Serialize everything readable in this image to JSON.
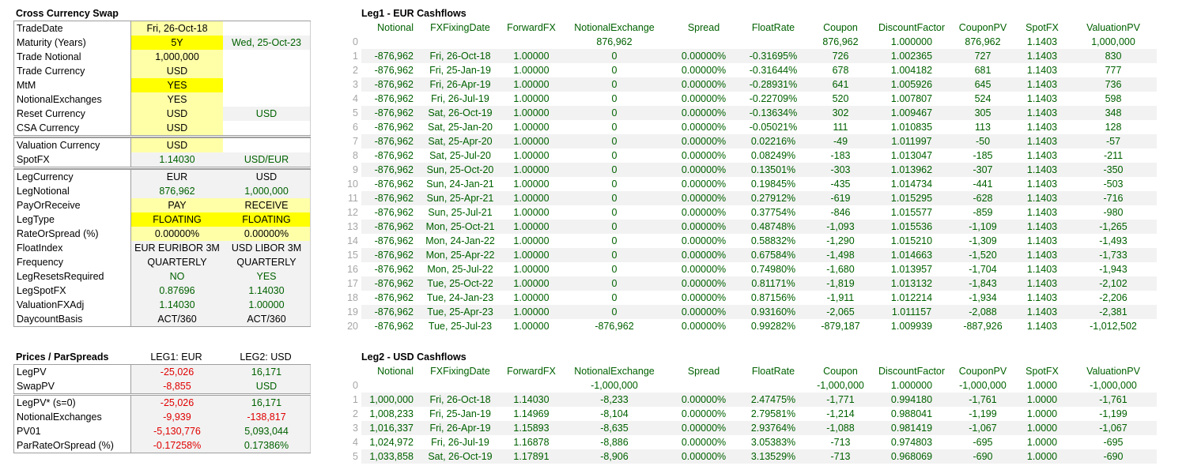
{
  "swap_panel": {
    "title": "Cross Currency Swap",
    "rows": [
      {
        "label": "TradeDate",
        "v1": "Fri, 26-Oct-18",
        "v2": ""
      },
      {
        "label": "Maturity (Years)",
        "v1": "5Y",
        "v2": "Wed, 25-Oct-23"
      },
      {
        "label": "Trade Notional",
        "v1": "1,000,000",
        "v2": ""
      },
      {
        "label": "Trade Currency",
        "v1": "USD",
        "v2": ""
      },
      {
        "label": "MtM",
        "v1": "YES",
        "v2": ""
      },
      {
        "label": "NotionalExchanges",
        "v1": "YES",
        "v2": ""
      },
      {
        "label": "Reset Currency",
        "v1": "USD",
        "v2": "USD"
      },
      {
        "label": "CSA Currency",
        "v1": "USD",
        "v2": ""
      },
      {
        "label": "Valuation Currency",
        "v1": "USD",
        "v2": ""
      },
      {
        "label": "SpotFX",
        "v1": "1.14030",
        "v2": "USD/EUR"
      },
      {
        "label": "LegCurrency",
        "v1": "EUR",
        "v2": "USD"
      },
      {
        "label": "LegNotional",
        "v1": "876,962",
        "v2": "1,000,000"
      },
      {
        "label": "PayOrReceive",
        "v1": "PAY",
        "v2": "RECEIVE"
      },
      {
        "label": "LegType",
        "v1": "FLOATING",
        "v2": "FLOATING"
      },
      {
        "label": "RateOrSpread (%)",
        "v1": "0.00000%",
        "v2": "0.00000%"
      },
      {
        "label": "FloatIndex",
        "v1": "EUR EURIBOR 3M",
        "v2": "USD LIBOR 3M"
      },
      {
        "label": "Frequency",
        "v1": "QUARTERLY",
        "v2": "QUARTERLY"
      },
      {
        "label": "LegResetsRequired",
        "v1": "NO",
        "v2": "YES"
      },
      {
        "label": "LegSpotFX",
        "v1": "0.87696",
        "v2": "1.14030"
      },
      {
        "label": "ValuationFXAdj",
        "v1": "1.14030",
        "v2": "1.00000"
      },
      {
        "label": "DaycountBasis",
        "v1": "ACT/360",
        "v2": "ACT/360"
      }
    ]
  },
  "prices_panel": {
    "title": "Prices / ParSpreads",
    "col1": "LEG1: EUR",
    "col2": "LEG2: USD",
    "rows": [
      {
        "label": "LegPV",
        "v1": "-25,026",
        "v2": "16,171"
      },
      {
        "label": "SwapPV",
        "v1": "-8,855",
        "v2": "USD"
      },
      {
        "label": "LegPV* (s=0)",
        "v1": "-25,026",
        "v2": "16,171"
      },
      {
        "label": "NotionalExchanges",
        "v1": "-9,939",
        "v2": "-138,817"
      },
      {
        "label": "PV01",
        "v1": "-5,130,776",
        "v2": "5,093,044"
      },
      {
        "label": "ParRateOrSpread (%)",
        "v1": "-0.17258%",
        "v2": "0.17386%"
      }
    ]
  },
  "leg1": {
    "title": "Leg1 - EUR Cashflows",
    "columns": [
      "Notional",
      "FXFixingDate",
      "ForwardFX",
      "NotionalExchange",
      "Spread",
      "FloatRate",
      "Coupon",
      "DiscountFactor",
      "CouponPV",
      "SpotFX",
      "ValuationPV"
    ],
    "rows": [
      [
        "0",
        "",
        "",
        "",
        "876,962",
        "",
        "",
        "876,962",
        "1.000000",
        "876,962",
        "1.1403",
        "1,000,000"
      ],
      [
        "1",
        "-876,962",
        "Fri, 26-Oct-18",
        "1.00000",
        "0",
        "0.00000%",
        "-0.31695%",
        "726",
        "1.002365",
        "727",
        "1.1403",
        "830"
      ],
      [
        "2",
        "-876,962",
        "Fri, 25-Jan-19",
        "1.00000",
        "0",
        "0.00000%",
        "-0.31644%",
        "678",
        "1.004182",
        "681",
        "1.1403",
        "777"
      ],
      [
        "3",
        "-876,962",
        "Fri, 26-Apr-19",
        "1.00000",
        "0",
        "0.00000%",
        "-0.28931%",
        "641",
        "1.005926",
        "645",
        "1.1403",
        "736"
      ],
      [
        "4",
        "-876,962",
        "Fri, 26-Jul-19",
        "1.00000",
        "0",
        "0.00000%",
        "-0.22709%",
        "520",
        "1.007807",
        "524",
        "1.1403",
        "598"
      ],
      [
        "5",
        "-876,962",
        "Sat, 26-Oct-19",
        "1.00000",
        "0",
        "0.00000%",
        "-0.13634%",
        "302",
        "1.009467",
        "305",
        "1.1403",
        "348"
      ],
      [
        "6",
        "-876,962",
        "Sat, 25-Jan-20",
        "1.00000",
        "0",
        "0.00000%",
        "-0.05021%",
        "111",
        "1.010835",
        "113",
        "1.1403",
        "128"
      ],
      [
        "7",
        "-876,962",
        "Sat, 25-Apr-20",
        "1.00000",
        "0",
        "0.00000%",
        "0.02216%",
        "-49",
        "1.011997",
        "-50",
        "1.1403",
        "-57"
      ],
      [
        "8",
        "-876,962",
        "Sat, 25-Jul-20",
        "1.00000",
        "0",
        "0.00000%",
        "0.08249%",
        "-183",
        "1.013047",
        "-185",
        "1.1403",
        "-211"
      ],
      [
        "9",
        "-876,962",
        "Sun, 25-Oct-20",
        "1.00000",
        "0",
        "0.00000%",
        "0.13501%",
        "-303",
        "1.013962",
        "-307",
        "1.1403",
        "-350"
      ],
      [
        "10",
        "-876,962",
        "Sun, 24-Jan-21",
        "1.00000",
        "0",
        "0.00000%",
        "0.19845%",
        "-435",
        "1.014734",
        "-441",
        "1.1403",
        "-503"
      ],
      [
        "11",
        "-876,962",
        "Sun, 25-Apr-21",
        "1.00000",
        "0",
        "0.00000%",
        "0.27912%",
        "-619",
        "1.015295",
        "-628",
        "1.1403",
        "-716"
      ],
      [
        "12",
        "-876,962",
        "Sun, 25-Jul-21",
        "1.00000",
        "0",
        "0.00000%",
        "0.37754%",
        "-846",
        "1.015577",
        "-859",
        "1.1403",
        "-980"
      ],
      [
        "13",
        "-876,962",
        "Mon, 25-Oct-21",
        "1.00000",
        "0",
        "0.00000%",
        "0.48748%",
        "-1,093",
        "1.015536",
        "-1,109",
        "1.1403",
        "-1,265"
      ],
      [
        "14",
        "-876,962",
        "Mon, 24-Jan-22",
        "1.00000",
        "0",
        "0.00000%",
        "0.58832%",
        "-1,290",
        "1.015210",
        "-1,309",
        "1.1403",
        "-1,493"
      ],
      [
        "15",
        "-876,962",
        "Mon, 25-Apr-22",
        "1.00000",
        "0",
        "0.00000%",
        "0.67584%",
        "-1,498",
        "1.014663",
        "-1,520",
        "1.1403",
        "-1,733"
      ],
      [
        "16",
        "-876,962",
        "Mon, 25-Jul-22",
        "1.00000",
        "0",
        "0.00000%",
        "0.74980%",
        "-1,680",
        "1.013957",
        "-1,704",
        "1.1403",
        "-1,943"
      ],
      [
        "17",
        "-876,962",
        "Tue, 25-Oct-22",
        "1.00000",
        "0",
        "0.00000%",
        "0.81171%",
        "-1,819",
        "1.013132",
        "-1,843",
        "1.1403",
        "-2,102"
      ],
      [
        "18",
        "-876,962",
        "Tue, 24-Jan-23",
        "1.00000",
        "0",
        "0.00000%",
        "0.87156%",
        "-1,911",
        "1.012214",
        "-1,934",
        "1.1403",
        "-2,206"
      ],
      [
        "19",
        "-876,962",
        "Tue, 25-Apr-23",
        "1.00000",
        "0",
        "0.00000%",
        "0.93160%",
        "-2,065",
        "1.011157",
        "-2,088",
        "1.1403",
        "-2,381"
      ],
      [
        "20",
        "-876,962",
        "Tue, 25-Jul-23",
        "1.00000",
        "-876,962",
        "0.00000%",
        "0.99282%",
        "-879,187",
        "1.009939",
        "-887,926",
        "1.1403",
        "-1,012,502"
      ]
    ]
  },
  "leg2": {
    "title": "Leg2 - USD Cashflows",
    "columns": [
      "Notional",
      "FXFixingDate",
      "ForwardFX",
      "NotionalExchange",
      "Spread",
      "FloatRate",
      "Coupon",
      "DiscountFactor",
      "CouponPV",
      "SpotFX",
      "ValuationPV"
    ],
    "rows": [
      [
        "0",
        "",
        "",
        "",
        "-1,000,000",
        "",
        "",
        "-1,000,000",
        "1.000000",
        "-1,000,000",
        "1.0000",
        "-1,000,000"
      ],
      [
        "1",
        "1,000,000",
        "Fri, 26-Oct-18",
        "1.14030",
        "-8,233",
        "0.00000%",
        "2.47475%",
        "-1,771",
        "0.994180",
        "-1,761",
        "1.0000",
        "-1,761"
      ],
      [
        "2",
        "1,008,233",
        "Fri, 25-Jan-19",
        "1.14969",
        "-8,104",
        "0.00000%",
        "2.79581%",
        "-1,214",
        "0.988041",
        "-1,199",
        "1.0000",
        "-1,199"
      ],
      [
        "3",
        "1,016,337",
        "Fri, 26-Apr-19",
        "1.15893",
        "-8,635",
        "0.00000%",
        "2.93764%",
        "-1,088",
        "0.981419",
        "-1,067",
        "1.0000",
        "-1,067"
      ],
      [
        "4",
        "1,024,972",
        "Fri, 26-Jul-19",
        "1.16878",
        "-8,886",
        "0.00000%",
        "3.05383%",
        "-713",
        "0.974803",
        "-695",
        "1.0000",
        "-695"
      ],
      [
        "5",
        "1,033,858",
        "Sat, 26-Oct-19",
        "1.17891",
        "-8,906",
        "0.00000%",
        "3.13529%",
        "-713",
        "0.968069",
        "-690",
        "1.0000",
        "-690"
      ]
    ]
  }
}
